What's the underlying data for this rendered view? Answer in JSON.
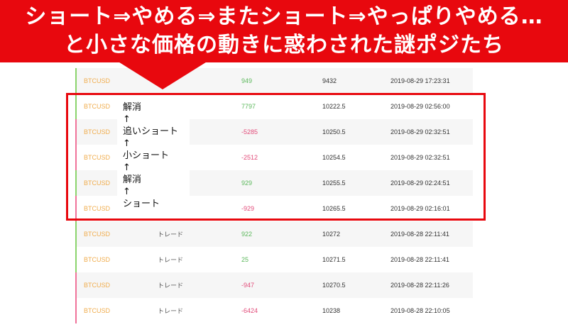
{
  "banner": {
    "line1": "ショート⇒やめる⇒またショート⇒やっぱりやめる…",
    "line2": "と小さな価格の動きに惑わされた謎ポジたち"
  },
  "colors": {
    "banner_red": "#e8080e",
    "buy_green": "#5cb85c",
    "sell_pink": "#e24c7a",
    "symbol_orange": "#f0ad4e"
  },
  "annotations": [
    {
      "text": "解消"
    },
    {
      "text": "↑"
    },
    {
      "text": "追いショート"
    },
    {
      "text": "↑"
    },
    {
      "text": "小ショート"
    },
    {
      "text": "↑"
    },
    {
      "text": "解消"
    },
    {
      "text": "↑"
    },
    {
      "text": "ショート"
    }
  ],
  "trades": [
    {
      "symbol": "BTCUSD",
      "type": "",
      "qty": "949",
      "price": "9432",
      "time": "2019-08-29 17:23:31",
      "side": "buy"
    },
    {
      "symbol": "BTCUSD",
      "type": "",
      "qty": "7797",
      "price": "10222.5",
      "time": "2019-08-29 02:56:00",
      "side": "buy"
    },
    {
      "symbol": "BTCUSD",
      "type": "",
      "qty": "-5285",
      "price": "10250.5",
      "time": "2019-08-29 02:32:51",
      "side": "sell"
    },
    {
      "symbol": "BTCUSD",
      "type": "",
      "qty": "-2512",
      "price": "10254.5",
      "time": "2019-08-29 02:32:51",
      "side": "sell"
    },
    {
      "symbol": "BTCUSD",
      "type": "",
      "qty": "929",
      "price": "10255.5",
      "time": "2019-08-29 02:24:51",
      "side": "buy"
    },
    {
      "symbol": "BTCUSD",
      "type": "",
      "qty": "-929",
      "price": "10265.5",
      "time": "2019-08-29 02:16:01",
      "side": "sell"
    },
    {
      "symbol": "BTCUSD",
      "type": "トレード",
      "qty": "922",
      "price": "10272",
      "time": "2019-08-28 22:11:41",
      "side": "buy"
    },
    {
      "symbol": "BTCUSD",
      "type": "トレード",
      "qty": "25",
      "price": "10271.5",
      "time": "2019-08-28 22:11:41",
      "side": "buy"
    },
    {
      "symbol": "BTCUSD",
      "type": "トレード",
      "qty": "-947",
      "price": "10270.5",
      "time": "2019-08-28 22:11:26",
      "side": "sell"
    },
    {
      "symbol": "BTCUSD",
      "type": "トレード",
      "qty": "-6424",
      "price": "10238",
      "time": "2019-08-28 22:10:05",
      "side": "sell"
    }
  ]
}
